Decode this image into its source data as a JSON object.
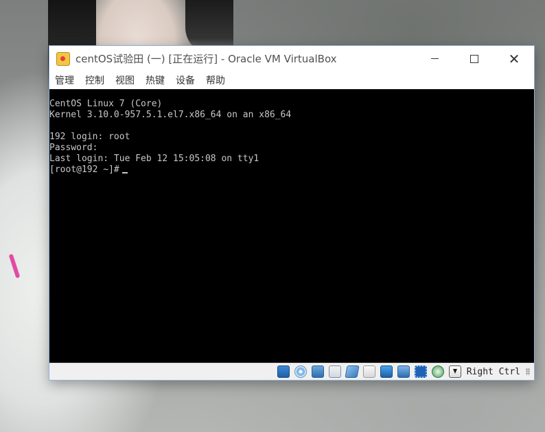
{
  "window": {
    "title": "centOS试验田 (一) [正在运行] - Oracle VM VirtualBox"
  },
  "menu": {
    "items": [
      "管理",
      "控制",
      "视图",
      "热键",
      "设备",
      "帮助"
    ]
  },
  "console": {
    "lines": [
      "CentOS Linux 7 (Core)",
      "Kernel 3.10.0-957.5.1.el7.x86_64 on an x86_64",
      "",
      "192 login: root",
      "Password:",
      "Last login: Tue Feb 12 15:05:08 on tty1",
      "[root@192 ~]#"
    ],
    "text_color": "#c8c8c8",
    "background": "#000000"
  },
  "statusbar": {
    "icons": [
      "hard-disk-icon",
      "optical-drive-icon",
      "audio-icon",
      "network-icon",
      "usb-icon",
      "shared-folder-icon",
      "display-icon",
      "recording-icon",
      "cpu-icon",
      "guest-additions-icon",
      "mouse-integration-icon"
    ],
    "host_key": "Right Ctrl"
  }
}
